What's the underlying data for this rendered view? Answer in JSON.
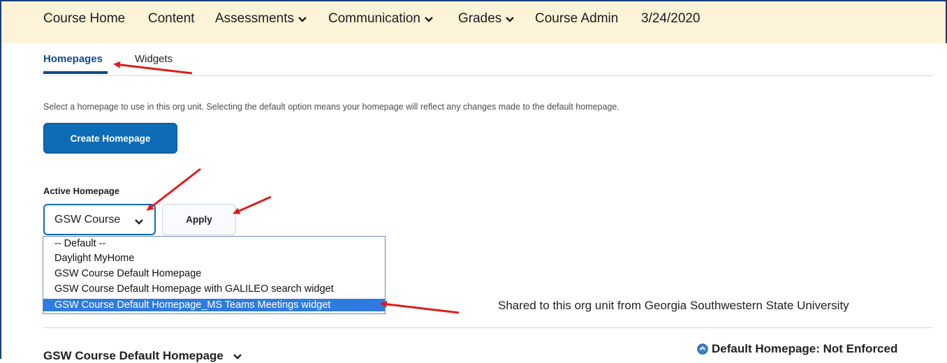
{
  "nav": {
    "items": [
      {
        "label": "Course Home"
      },
      {
        "label": "Content"
      },
      {
        "label": "Assessments"
      },
      {
        "label": "Communication"
      },
      {
        "label": "Grades"
      },
      {
        "label": "Course Admin"
      },
      {
        "label": "3/24/2020"
      }
    ]
  },
  "tabs": [
    {
      "label": "Homepages",
      "active": true
    },
    {
      "label": "Widgets",
      "active": false
    }
  ],
  "description": "Select a homepage to use in this org unit. Selecting the default option means your homepage will reflect any changes made to the default homepage.",
  "create_button": "Create Homepage",
  "active_homepage": {
    "label": "Active Homepage",
    "selected_value": "GSW Course",
    "apply_label": "Apply",
    "options": [
      "-- Default --",
      "Daylight MyHome",
      "GSW Course Default Homepage",
      "GSW Course Default Homepage with GALILEO search widget",
      "GSW Course Default Homepage_MS Teams Meetings widget"
    ],
    "highlighted_option_index": 4
  },
  "shared_text": "Shared to this org unit from Georgia Southwestern State University",
  "homepage_section": {
    "title": "GSW Course Default Homepage",
    "status": "Default Homepage: Not Enforced"
  },
  "colors": {
    "nav_bg": "#fdf3d8",
    "accent": "#0e6bb5",
    "tab_active": "#124a8a",
    "selected_option": "#2f7be0",
    "annotation_arrow": "#e01b1b"
  }
}
